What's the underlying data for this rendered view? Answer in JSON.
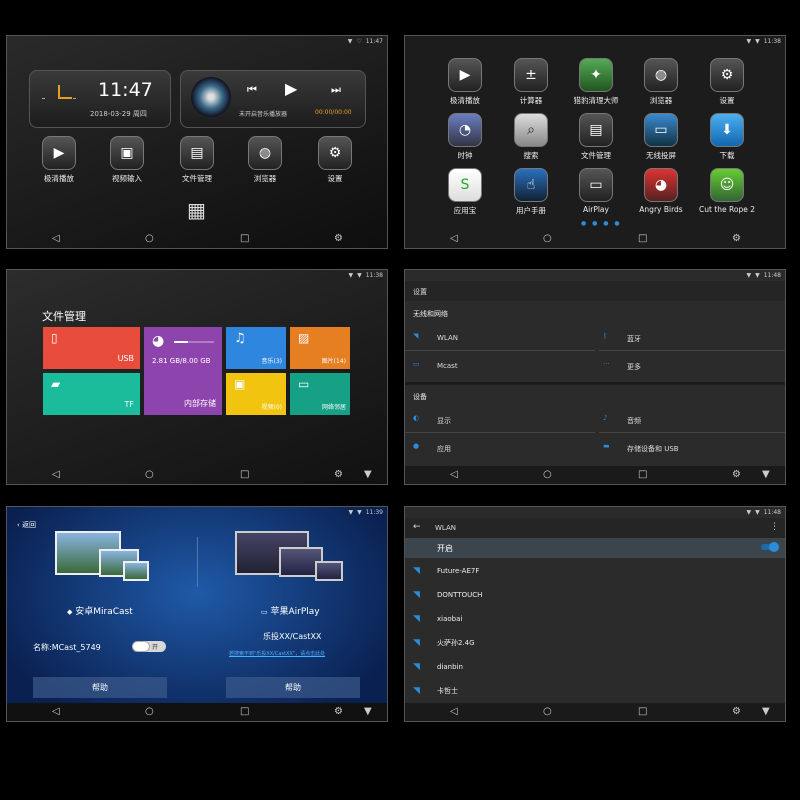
{
  "home": {
    "time": "11:47",
    "status_time": "11:47",
    "date": "2018-03-29",
    "weekday": "周四",
    "music_title": "未开启音乐播放器",
    "music_time": "00:00/00:00",
    "apps": [
      "极清播放",
      "视频输入",
      "文件管理",
      "浏览器",
      "设置"
    ]
  },
  "drawer": {
    "status_time": "11:38",
    "apps": [
      "极清播放",
      "计算器",
      "猎豹清理大师",
      "浏览器",
      "设置",
      "时钟",
      "搜索",
      "文件管理",
      "无线投屏",
      "下载",
      "应用宝",
      "用户手册",
      "AirPlay",
      "Angry Birds",
      "Cut the Rope 2"
    ]
  },
  "files": {
    "status_time": "11:38",
    "title": "文件管理",
    "usb": "USB",
    "tf": "TF",
    "storage_size": "2.81 GB/8.00 GB",
    "internal": "内部存储",
    "music": "音乐(3)",
    "pictures": "图片(14)",
    "video": "视频(0)",
    "network": "网络邻居"
  },
  "settings": {
    "status_time": "11:48",
    "title": "设置",
    "section_wireless": "无线和网络",
    "wlan": "WLAN",
    "bluetooth": "蓝牙",
    "mcast": "Mcast",
    "more": "更多",
    "section_device": "设备",
    "display": "显示",
    "sound": "音频",
    "apps": "应用",
    "storage": "存储设备和 USB"
  },
  "cast": {
    "status_time": "11:39",
    "back": "返回",
    "miracast": "安卓MiraCast",
    "airplay": "苹果AirPlay",
    "name": "名称:MCast_5749",
    "toggle": "开",
    "airplay_sub": "乐投XX/CastXX",
    "airplay_link": "若搜索不到\"乐投XX/CastXX\"，请点击此处",
    "help1": "帮助",
    "help2": "帮助"
  },
  "wlan": {
    "status_time": "11:48",
    "title": "WLAN",
    "toggle_label": "开启",
    "networks": [
      "Future-AE7F",
      "DONTTOUCH",
      "xiaobai",
      "火萨孙2.4G",
      "dianbin",
      "卡哲士"
    ]
  }
}
